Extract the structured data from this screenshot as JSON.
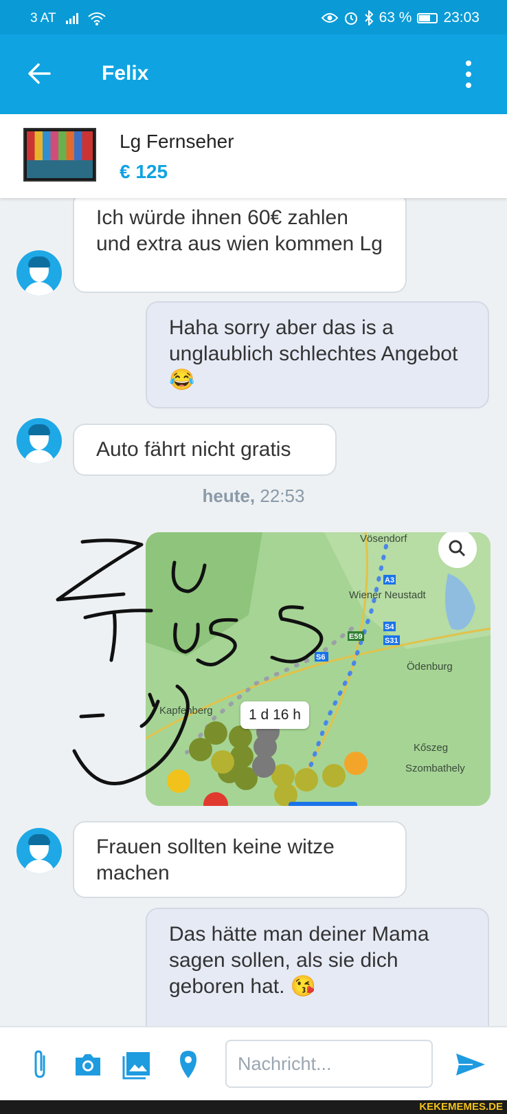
{
  "status_bar": {
    "carrier": "3 AT",
    "battery": "63 %",
    "time": "23:03"
  },
  "header": {
    "title": "Felix"
  },
  "product": {
    "title": "Lg Fernseher",
    "price": "€ 125"
  },
  "messages": [
    {
      "direction": "in",
      "text": "Ich würde ihnen 60€ zahlen und extra aus wien kommen Lg"
    },
    {
      "direction": "out",
      "text": "Haha sorry aber das is a unglaublich schlechtes Angebot 😂"
    },
    {
      "direction": "in",
      "text": "Auto fährt nicht gratis"
    },
    {
      "direction": "in",
      "text": "Frauen sollten keine witze machen"
    },
    {
      "direction": "out",
      "text": "Das hätte man deiner Mama sagen sollen, als sie dich geboren hat. 😘"
    }
  ],
  "timestamp": {
    "day": "heute,",
    "time": "22:53"
  },
  "map": {
    "labels": [
      "Vösendorf",
      "Wiener Neustadt",
      "Ödenburg",
      "Kapfenberg",
      "Kőszeg",
      "Szombathely",
      "A3",
      "S4",
      "S31",
      "E59",
      "S6"
    ],
    "route_duration": "1 d 16 h"
  },
  "composer": {
    "placeholder": "Nachricht..."
  },
  "watermark": "KEKEMEMES.DE",
  "colors": {
    "brand": "#0fa3e2",
    "status_bar": "#0a9bd6",
    "price": "#0fa3e2"
  }
}
